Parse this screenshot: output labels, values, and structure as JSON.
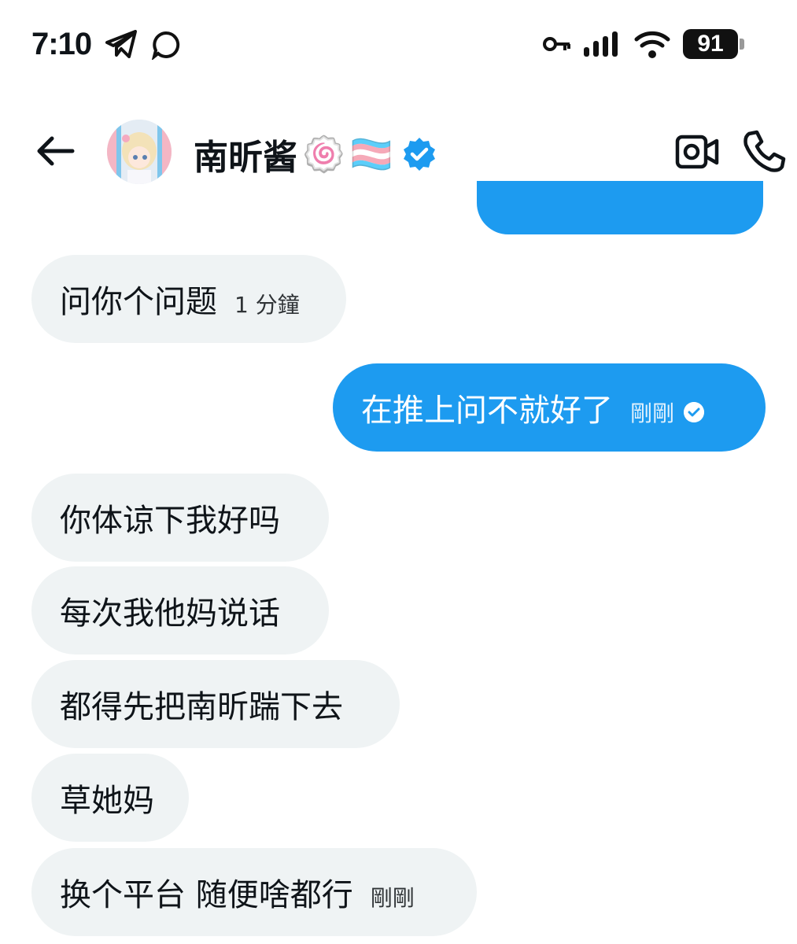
{
  "status_bar": {
    "time": "7:10",
    "battery": "91",
    "icons": [
      "telegram-send-icon",
      "chat-bubble-icon",
      "vpn-key-icon",
      "signal-icon",
      "wifi-icon",
      "battery-icon"
    ]
  },
  "header": {
    "contact_name": "南昕酱",
    "emoji": [
      "🍥",
      "🏳️‍⚧️"
    ],
    "verified": true,
    "icons": [
      "back-arrow-icon",
      "video-call-icon",
      "phone-call-icon"
    ]
  },
  "messages": [
    {
      "direction": "incoming",
      "text": "问你个问题",
      "time": "1 分鐘"
    },
    {
      "direction": "outgoing",
      "text": "在推上问不就好了",
      "time": "剛剛",
      "read": true
    },
    {
      "direction": "incoming",
      "text": "你体谅下我好吗",
      "time": ""
    },
    {
      "direction": "incoming",
      "text": "每次我他妈说话",
      "time": ""
    },
    {
      "direction": "incoming",
      "text": "都得先把南昕踹下去",
      "time": ""
    },
    {
      "direction": "incoming",
      "text": "草她妈",
      "time": ""
    },
    {
      "direction": "incoming",
      "text": "换个平台 随便啥都行",
      "time": "剛剛"
    }
  ],
  "colors": {
    "outgoing_bubble": "#1d9bf0",
    "incoming_bubble": "#eff3f4",
    "verified_badge": "#1d9bf0"
  }
}
